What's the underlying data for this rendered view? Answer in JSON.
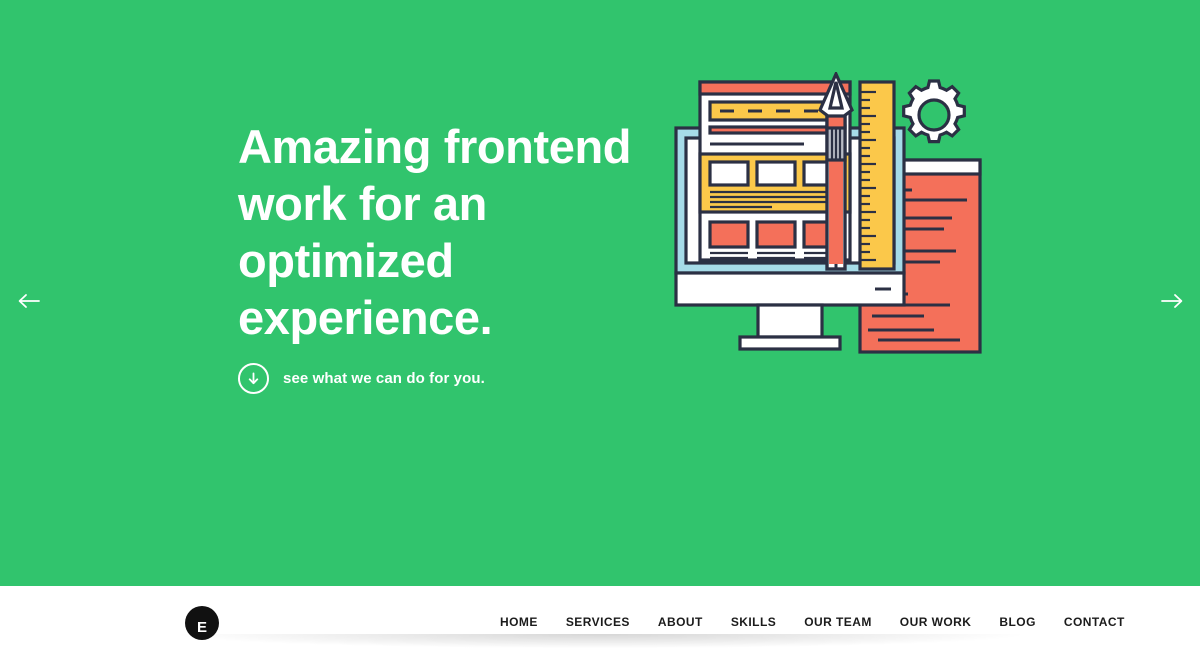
{
  "hero": {
    "background_color": "#31c46d",
    "headline": "Amazing frontend work for an optimized experience.",
    "subline": {
      "icon": "arrow-down-circle-icon",
      "text": "see what we can do for you."
    },
    "carousel": {
      "prev_icon": "arrow-left-icon",
      "prev_label": "←",
      "next_icon": "arrow-right-icon",
      "next_label": "→"
    },
    "illustration": {
      "name": "frontend-workspace-illustration",
      "alt": "Desktop monitor showing a website wireframe with a fountain pen, ruler, gear and code document",
      "colors": {
        "outline": "#2b3044",
        "orange": "#f4705a",
        "yellow": "#fbc84a",
        "light_blue": "#a6dbe8",
        "white": "#ffffff"
      },
      "elements": [
        "monitor",
        "webpage-wireframe",
        "fountain-pen",
        "ruler",
        "gear",
        "code-document"
      ]
    }
  },
  "navbar": {
    "background_color": "#ffffff",
    "logo": {
      "name": "brand-logo",
      "letter": "E"
    },
    "items": [
      {
        "label": "HOME"
      },
      {
        "label": "SERVICES"
      },
      {
        "label": "ABOUT"
      },
      {
        "label": "SKILLS"
      },
      {
        "label": "OUR TEAM"
      },
      {
        "label": "OUR WORK"
      },
      {
        "label": "BLOG"
      },
      {
        "label": "CONTACT"
      }
    ]
  }
}
